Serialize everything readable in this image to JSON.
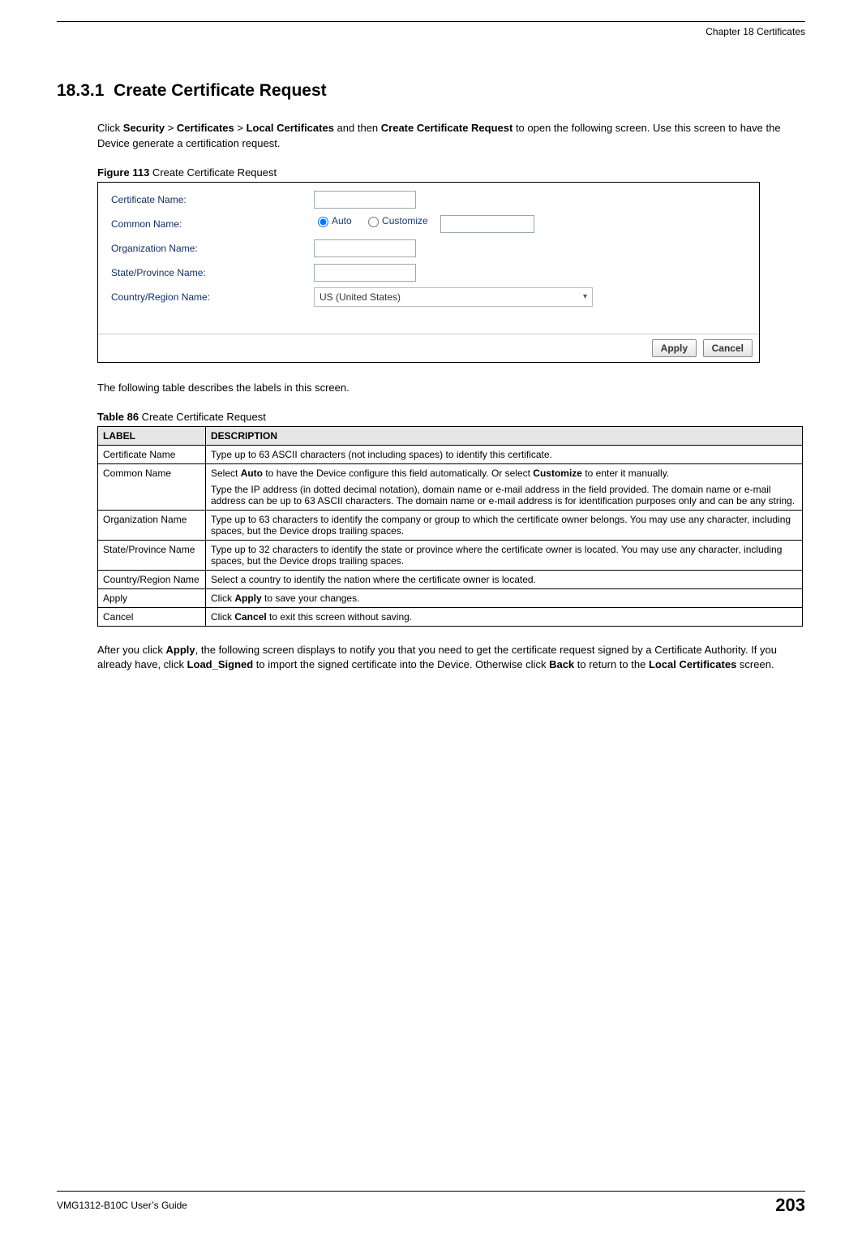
{
  "chapter": "Chapter 18 Certificates",
  "section_number": "18.3.1",
  "section_title": "Create Certificate Request",
  "intro_prefix": "Click ",
  "path1": "Security",
  "sep": " > ",
  "path2": "Certificates",
  "path3": "Local Certificates",
  "intro_mid": " and then ",
  "path4": "Create Certificate Request",
  "intro_suffix": " to open the following screen. Use this screen to have the Device generate a certification request.",
  "figure_label": "Figure 113",
  "figure_title": "   Create Certificate Request",
  "fig": {
    "cert_name_label": "Certificate Name:",
    "common_name_label": "Common Name:",
    "auto_label": "Auto",
    "customize_label": "Customize",
    "org_label": "Organization Name:",
    "state_label": "State/Province Name:",
    "country_label": "Country/Region Name:",
    "country_value": "US (United States)",
    "apply_btn": "Apply",
    "cancel_btn": "Cancel"
  },
  "mid_para": "The following table describes the labels in this screen.",
  "table_label": "Table 86",
  "table_title": "   Create Certificate Request",
  "col_label": "LABEL",
  "col_desc": "DESCRIPTION",
  "rows": {
    "r0l": "Certificate Name",
    "r0d": "Type up to 63 ASCII characters (not including spaces) to identify this certificate.",
    "r1l": "Common Name",
    "r1d_pre": "Select ",
    "r1d_b1": "Auto",
    "r1d_mid1": " to have the Device configure this field automatically. Or select ",
    "r1d_b2": "Customize",
    "r1d_mid2": " to enter it manually.",
    "r1d_p2": "Type the IP address (in dotted decimal notation), domain name or e-mail address in the field provided. The domain name or e-mail address can be up to 63 ASCII characters. The domain name or e-mail address is for identification purposes only and can be any string.",
    "r2l": "Organization Name",
    "r2d": "Type up to 63 characters to identify the company or group to which the certificate owner belongs. You may use any character, including spaces, but the Device drops trailing spaces.",
    "r3l": "State/Province Name",
    "r3d": "Type up to 32 characters to identify the state or province where the certificate owner is located. You may use any character, including spaces, but the Device drops trailing spaces.",
    "r4l": "Country/Region Name",
    "r4d": "Select a country to identify the nation where the certificate owner is located.",
    "r5l": "Apply",
    "r5d_pre": "Click ",
    "r5d_b": "Apply",
    "r5d_post": " to save your changes.",
    "r6l": "Cancel",
    "r6d_pre": "Click ",
    "r6d_b": "Cancel",
    "r6d_post": " to exit this screen without saving."
  },
  "after_pre": "After you click ",
  "after_b1": "Apply",
  "after_mid1": ", the following screen displays to notify you that you need to get the certificate request signed by a Certificate Authority. If you already have, click ",
  "after_b2": "Load_Signed",
  "after_mid2": " to import the signed certificate into the Device. Otherwise click ",
  "after_b3": "Back",
  "after_mid3": " to return to the ",
  "after_b4": "Local Certificates",
  "after_post": " screen.",
  "footer_guide": "VMG1312-B10C User’s Guide",
  "page_number": "203"
}
